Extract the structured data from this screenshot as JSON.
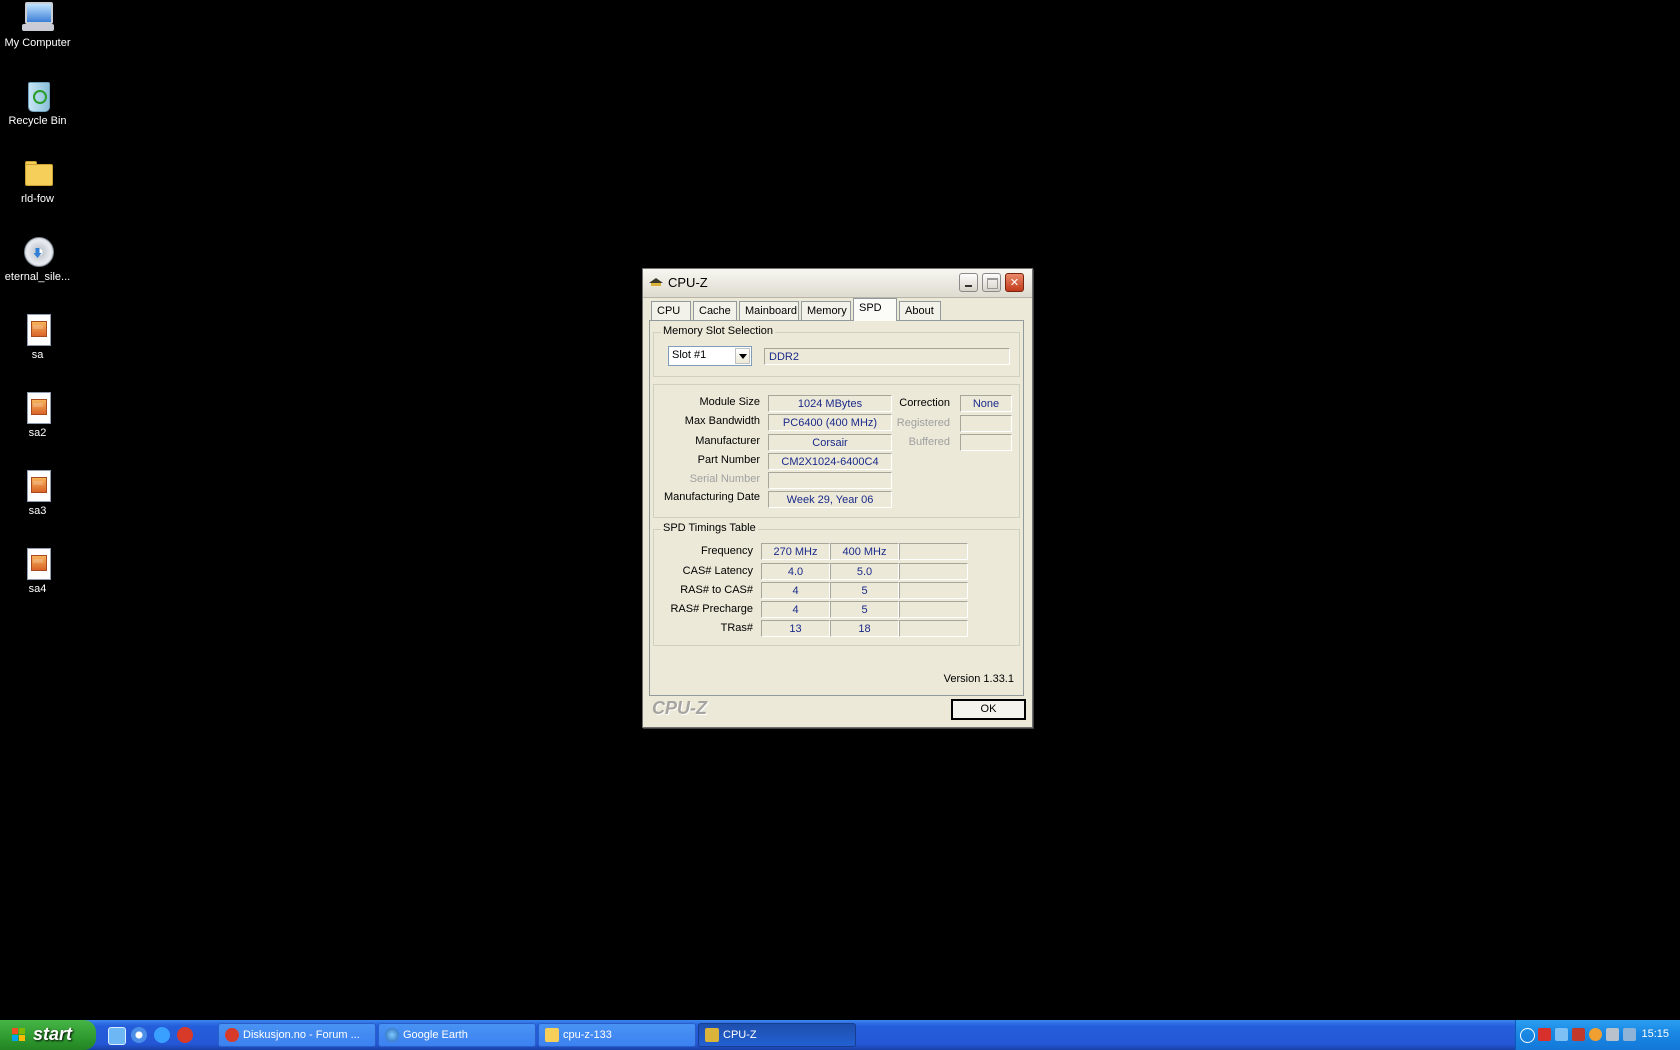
{
  "desktop": {
    "icons": [
      {
        "label": "My Computer"
      },
      {
        "label": "Recycle Bin"
      },
      {
        "label": "rld-fow"
      },
      {
        "label": "eternal_sile..."
      },
      {
        "label": "sa"
      },
      {
        "label": "sa2"
      },
      {
        "label": "sa3"
      },
      {
        "label": "sa4"
      }
    ]
  },
  "window": {
    "title": "CPU-Z",
    "tabs": [
      {
        "label": "CPU"
      },
      {
        "label": "Cache"
      },
      {
        "label": "Mainboard"
      },
      {
        "label": "Memory"
      },
      {
        "label": "SPD",
        "active": true
      },
      {
        "label": "About"
      }
    ],
    "slot_group": {
      "title": "Memory Slot Selection",
      "slot_value": "Slot #1",
      "memory_type": "DDR2"
    },
    "module": {
      "module_size_label": "Module Size",
      "module_size": "1024 MBytes",
      "max_bandwidth_label": "Max Bandwidth",
      "max_bandwidth": "PC6400 (400 MHz)",
      "manufacturer_label": "Manufacturer",
      "manufacturer": "Corsair",
      "part_number_label": "Part Number",
      "part_number": "CM2X1024-6400C4",
      "serial_number_label": "Serial Number",
      "serial_number": "",
      "mfg_date_label": "Manufacturing Date",
      "mfg_date": "Week 29, Year 06",
      "correction_label": "Correction",
      "correction": "None",
      "registered_label": "Registered",
      "registered": "",
      "buffered_label": "Buffered",
      "buffered": ""
    },
    "timings": {
      "title": "SPD Timings Table",
      "rows": [
        {
          "label": "Frequency",
          "values": [
            "270 MHz",
            "400 MHz",
            ""
          ]
        },
        {
          "label": "CAS# Latency",
          "values": [
            "4.0",
            "5.0",
            ""
          ]
        },
        {
          "label": "RAS# to CAS#",
          "values": [
            "4",
            "5",
            ""
          ]
        },
        {
          "label": "RAS# Precharge",
          "values": [
            "4",
            "5",
            ""
          ]
        },
        {
          "label": "TRas#",
          "values": [
            "13",
            "18",
            ""
          ]
        }
      ]
    },
    "version": "Version 1.33.1",
    "brand": "CPU-Z",
    "ok_label": "OK"
  },
  "taskbar": {
    "start_label": "start",
    "items": [
      {
        "label": "Diskusjon.no - Forum ..."
      },
      {
        "label": "Google Earth"
      },
      {
        "label": "cpu-z-133"
      },
      {
        "label": "CPU-Z",
        "active": true
      }
    ],
    "clock": "15:15"
  }
}
